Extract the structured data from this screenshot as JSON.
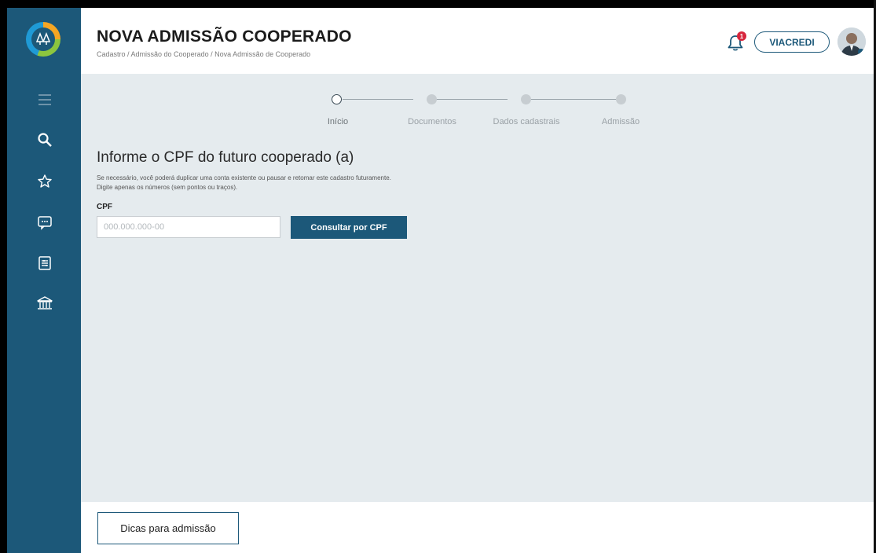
{
  "header": {
    "title": "NOVA ADMISSÃO COOPERADO",
    "breadcrumb": "Cadastro / Admissão do Cooperado / Nova Admissão de Cooperado",
    "notification_count": "1",
    "cooperative": "VIACREDI"
  },
  "sidebar": {
    "icons": [
      "menu-icon",
      "search-icon",
      "star-icon",
      "chat-icon",
      "forms-icon",
      "bank-icon"
    ]
  },
  "steps": [
    {
      "label": "Início",
      "active": true
    },
    {
      "label": "Documentos",
      "active": false
    },
    {
      "label": "Dados cadastrais",
      "active": false
    },
    {
      "label": "Admissão",
      "active": false
    }
  ],
  "form": {
    "title": "Informe o CPF do futuro cooperado (a)",
    "help_line1": "Se necessário, você poderá duplicar uma conta existente ou pausar e retomar este cadastro futuramente.",
    "help_line2": "Digite apenas os números (sem pontos ou traços).",
    "cpf_label": "CPF",
    "cpf_placeholder": "000.000.000-00",
    "cpf_value": "",
    "consult_button": "Consultar por CPF"
  },
  "footer": {
    "tips_button": "Dicas para admissão"
  },
  "colors": {
    "primary": "#1c5879",
    "background": "#e5ebee",
    "badge": "#d7263d"
  }
}
